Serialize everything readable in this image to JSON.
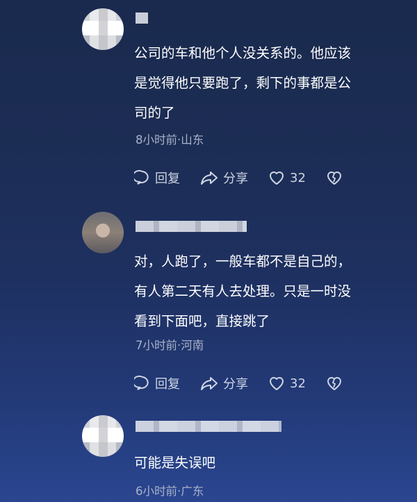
{
  "comments": [
    {
      "text": "公司的车和他个人没关系的。他应该\n是觉得他只要跑了，剩下的事都是公\n司的了",
      "meta": "8小时前·山东",
      "reply_label": "回复",
      "share_label": "分享",
      "likes": "32"
    },
    {
      "text": "对，人跑了，一般车都不是自己的，\n有人第二天有人去处理。只是一时没\n看到下面吧，直接跳了",
      "meta": "7小时前·河南",
      "reply_label": "回复",
      "share_label": "分享",
      "likes": "32"
    },
    {
      "text": "可能是失误吧",
      "meta": "6小时前·广东"
    }
  ],
  "colors": {
    "text": "#ffffff",
    "meta": "#a9b2c8",
    "action": "#cfd5e3"
  },
  "icons": [
    "reply-bubble-icon",
    "share-arrow-icon",
    "heart-icon",
    "broken-heart-icon"
  ]
}
